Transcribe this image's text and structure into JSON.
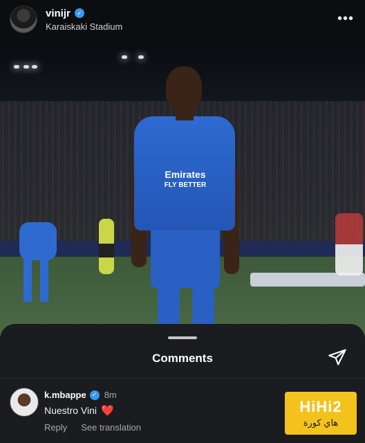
{
  "header": {
    "username": "vinijr",
    "location": "Karaiskaki Stadium",
    "more_glyph": "•••"
  },
  "photo": {
    "sponsor_line1": "Emirates",
    "sponsor_line2": "FLY BETTER"
  },
  "comments_sheet": {
    "title": "Comments",
    "comment": {
      "username": "k.mbappe",
      "time": "8m",
      "text": "Nuestro Vini",
      "emoji": "❤️",
      "reply_label": "Reply",
      "translate_label": "See translation"
    }
  },
  "watermark": {
    "latin": "HiHi2",
    "arabic": "هاي كورة"
  },
  "colors": {
    "verified": "#3897f0",
    "sheet_bg": "#1b1c20",
    "header_bg": "#0c0d10",
    "heart": "#ed2f3c",
    "watermark_bg": "#f4c21c"
  },
  "icons": [
    "verified-badge-icon",
    "more-options-icon",
    "send-icon",
    "heart-emoji"
  ]
}
